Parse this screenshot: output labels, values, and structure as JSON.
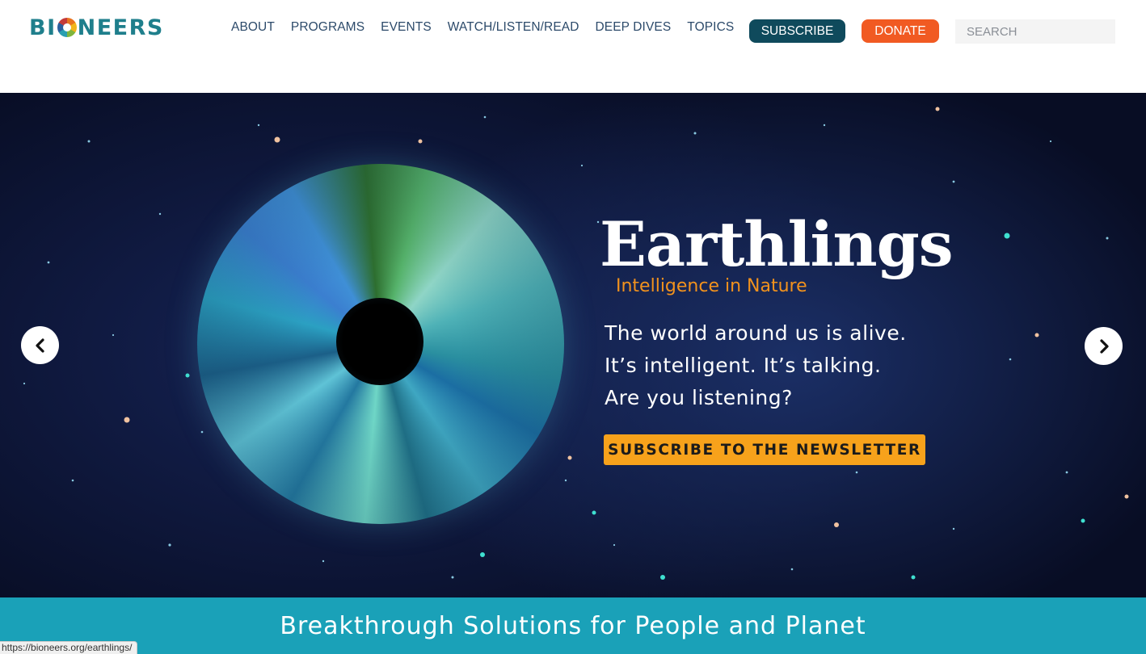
{
  "logo": {
    "pre": "BI",
    "post": "NEERS"
  },
  "nav": [
    {
      "label": "ABOUT"
    },
    {
      "label": "PROGRAMS"
    },
    {
      "label": "EVENTS"
    },
    {
      "label": "WATCH/LISTEN/READ"
    },
    {
      "label": "DEEP DIVES"
    },
    {
      "label": "TOPICS"
    }
  ],
  "header": {
    "subscribe_label": "SUBSCRIBE",
    "donate_label": "DONATE",
    "search_placeholder": "SEARCH"
  },
  "hero": {
    "title": "Earthlings",
    "subtitle": "Intelligence in Nature",
    "lines": [
      "The world around us is alive.",
      "It’s intelligent. It’s talking.",
      "Are you listening?"
    ],
    "cta_label": "SUBSCRIBE TO THE NEWSLETTER",
    "prev_icon": "chevron-left-icon",
    "next_icon": "chevron-right-icon"
  },
  "banner": {
    "text": "Breakthrough Solutions for People and Planet"
  },
  "status_bar": {
    "url": "https://bioneers.org/earthlings/"
  },
  "colors": {
    "brand_teal": "#1f7f8c",
    "nav_text": "#2c4a6a",
    "subscribe_bg": "#0f4a5c",
    "donate_bg": "#f15a22",
    "hero_accent": "#f2921d",
    "cta_bg": "#f7a21b",
    "banner_bg": "#1aa1b8"
  }
}
